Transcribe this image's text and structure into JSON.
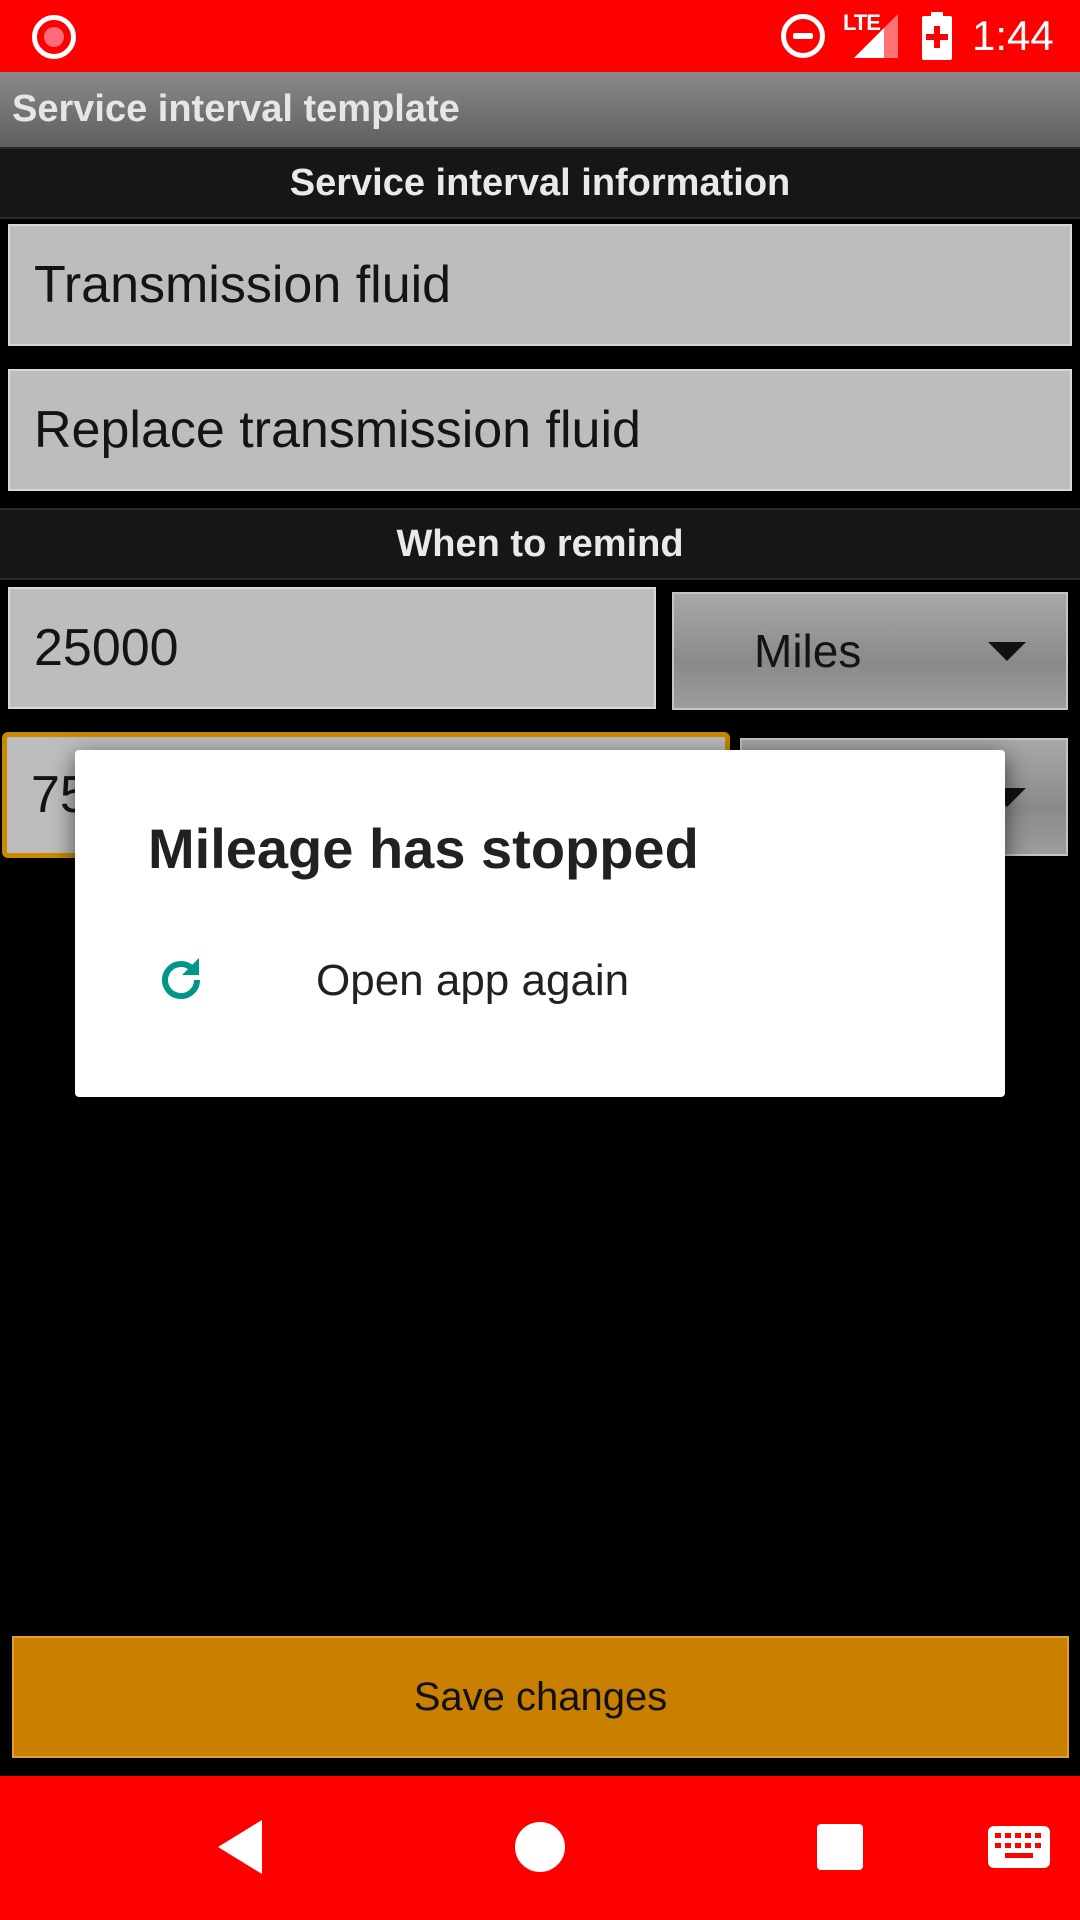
{
  "status_bar": {
    "network_label": "LTE",
    "time": "1:44",
    "icons": [
      "screen-record-icon",
      "do-not-disturb-icon",
      "signal-icon",
      "battery-charging-icon"
    ],
    "background_color": "#ff0000"
  },
  "app_bar": {
    "title": "Service interval template"
  },
  "sections": {
    "info_header": "Service interval information",
    "remind_header": "When to remind"
  },
  "form": {
    "name_value": "Transmission fluid",
    "description_value": "Replace transmission fluid",
    "interval_value": "25000",
    "interval_unit": "Miles",
    "second_interval_value": "75"
  },
  "save_button": {
    "label": "Save changes",
    "color": "#c98000"
  },
  "dialog": {
    "title": "Mileage has stopped",
    "action_label": "Open app again",
    "action_icon": "refresh-icon",
    "icon_color": "#009688"
  },
  "nav_bar": {
    "icons": [
      "back-icon",
      "home-icon",
      "recents-icon",
      "keyboard-icon"
    ]
  }
}
